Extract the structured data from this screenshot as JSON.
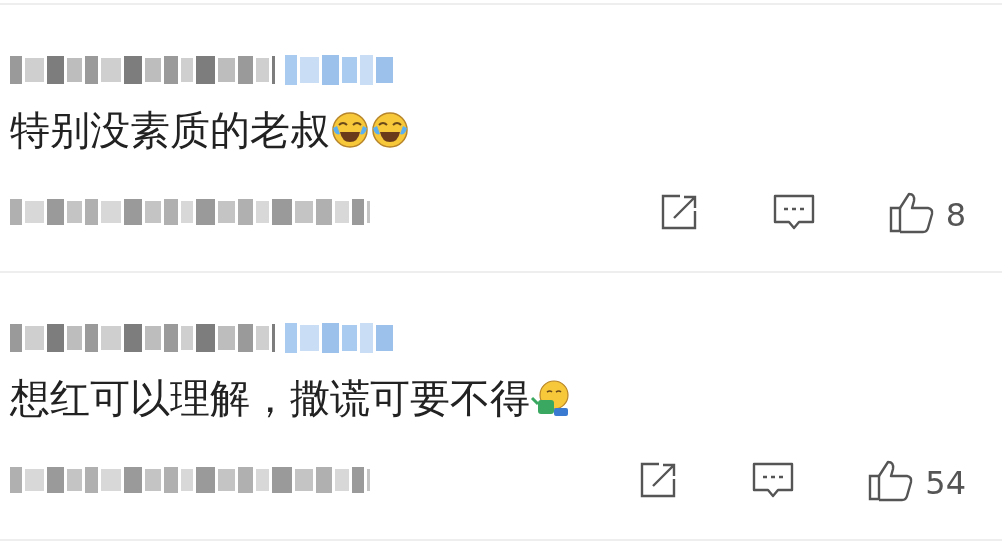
{
  "comments": [
    {
      "text": "特别没素质的老叔",
      "emojis": [
        {
          "kind": "tears-of-joy"
        },
        {
          "kind": "tears-of-joy"
        }
      ],
      "like_count": "8"
    },
    {
      "text": "想红可以理解，撒谎可要不得",
      "emojis": [
        {
          "kind": "watering-can"
        }
      ],
      "like_count": "54"
    }
  ]
}
